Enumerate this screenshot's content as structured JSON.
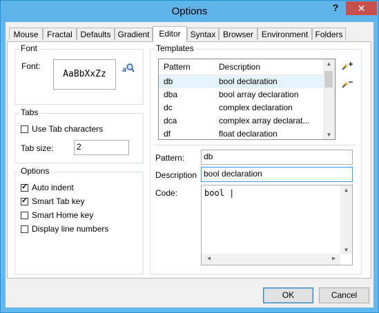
{
  "window": {
    "title": "Options",
    "help_label": "?",
    "close_label": "✕"
  },
  "tabs": [
    {
      "label": "Mouse"
    },
    {
      "label": "Fractal"
    },
    {
      "label": "Defaults"
    },
    {
      "label": "Gradient"
    },
    {
      "label": "Editor",
      "active": true
    },
    {
      "label": "Syntax"
    },
    {
      "label": "Browser"
    },
    {
      "label": "Environment"
    },
    {
      "label": "Folders"
    }
  ],
  "font_group": {
    "legend": "Font",
    "font_label": "Font:",
    "sample": "AaBbXxZz",
    "choose_icon": "font-search-icon"
  },
  "tabs_group": {
    "legend": "Tabs",
    "use_tab_label": "Use Tab characters",
    "use_tab_checked": false,
    "tab_size_label": "Tab size:",
    "tab_size_value": "2"
  },
  "options_group": {
    "legend": "Options",
    "items": [
      {
        "label": "Auto indent",
        "checked": true
      },
      {
        "label": "Smart Tab key",
        "checked": true
      },
      {
        "label": "Smart Home key",
        "checked": false
      },
      {
        "label": "Display line numbers",
        "checked": false
      }
    ]
  },
  "templates": {
    "legend": "Templates",
    "col_pattern": "Pattern",
    "col_description": "Description",
    "rows": [
      {
        "pattern": "db",
        "description": "bool declaration",
        "selected": true
      },
      {
        "pattern": "dba",
        "description": "bool array declaration"
      },
      {
        "pattern": "dc",
        "description": "complex declaration"
      },
      {
        "pattern": "dca",
        "description": "complex array declarat..."
      },
      {
        "pattern": "df",
        "description": "float declaration"
      }
    ],
    "add_icon": "add-template-icon",
    "remove_icon": "remove-template-icon",
    "pattern_label": "Pattern:",
    "pattern_value": "db",
    "description_label": "Description",
    "description_value": "bool declaration",
    "code_label": "Code:",
    "code_value": "bool |"
  },
  "buttons": {
    "ok": "OK",
    "cancel": "Cancel"
  }
}
